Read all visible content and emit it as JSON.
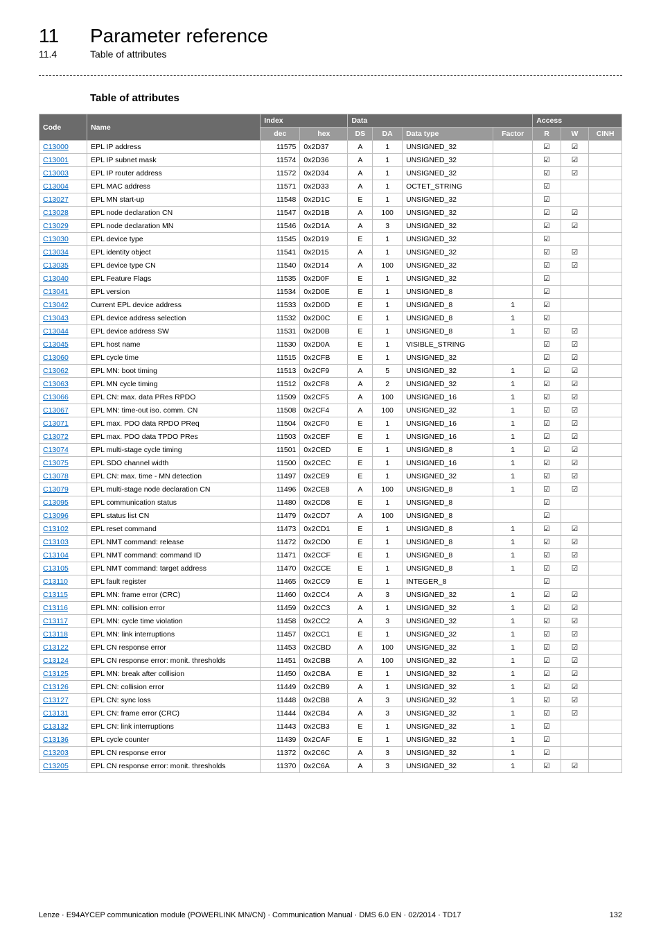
{
  "header": {
    "chapter_num": "11",
    "chapter_title": "Parameter reference",
    "section_num": "11.4",
    "section_title": "Table of attributes"
  },
  "table": {
    "title": "Table of attributes",
    "col_groups": {
      "code": "Code",
      "name": "Name",
      "index": "Index",
      "data": "Data",
      "access": "Access"
    },
    "cols": {
      "dec": "dec",
      "hex": "hex",
      "ds": "DS",
      "da": "DA",
      "dtype": "Data type",
      "factor": "Factor",
      "r": "R",
      "w": "W",
      "cinh": "CINH"
    },
    "check": "☑",
    "rows": [
      {
        "code": "C13000",
        "name": "EPL IP address",
        "dec": "11575",
        "hex": "0x2D37",
        "ds": "A",
        "da": "1",
        "dtype": "UNSIGNED_32",
        "factor": "",
        "r": true,
        "w": true,
        "cinh": false
      },
      {
        "code": "C13001",
        "name": "EPL IP subnet mask",
        "dec": "11574",
        "hex": "0x2D36",
        "ds": "A",
        "da": "1",
        "dtype": "UNSIGNED_32",
        "factor": "",
        "r": true,
        "w": true,
        "cinh": false
      },
      {
        "code": "C13003",
        "name": "EPL IP router address",
        "dec": "11572",
        "hex": "0x2D34",
        "ds": "A",
        "da": "1",
        "dtype": "UNSIGNED_32",
        "factor": "",
        "r": true,
        "w": true,
        "cinh": false
      },
      {
        "code": "C13004",
        "name": "EPL MAC address",
        "dec": "11571",
        "hex": "0x2D33",
        "ds": "A",
        "da": "1",
        "dtype": "OCTET_STRING",
        "factor": "",
        "r": true,
        "w": false,
        "cinh": false
      },
      {
        "code": "C13027",
        "name": "EPL MN start-up",
        "dec": "11548",
        "hex": "0x2D1C",
        "ds": "E",
        "da": "1",
        "dtype": "UNSIGNED_32",
        "factor": "",
        "r": true,
        "w": false,
        "cinh": false
      },
      {
        "code": "C13028",
        "name": "EPL node declaration CN",
        "dec": "11547",
        "hex": "0x2D1B",
        "ds": "A",
        "da": "100",
        "dtype": "UNSIGNED_32",
        "factor": "",
        "r": true,
        "w": true,
        "cinh": false
      },
      {
        "code": "C13029",
        "name": "EPL node declaration MN",
        "dec": "11546",
        "hex": "0x2D1A",
        "ds": "A",
        "da": "3",
        "dtype": "UNSIGNED_32",
        "factor": "",
        "r": true,
        "w": true,
        "cinh": false
      },
      {
        "code": "C13030",
        "name": "EPL device type",
        "dec": "11545",
        "hex": "0x2D19",
        "ds": "E",
        "da": "1",
        "dtype": "UNSIGNED_32",
        "factor": "",
        "r": true,
        "w": false,
        "cinh": false
      },
      {
        "code": "C13034",
        "name": "EPL identity object",
        "dec": "11541",
        "hex": "0x2D15",
        "ds": "A",
        "da": "1",
        "dtype": "UNSIGNED_32",
        "factor": "",
        "r": true,
        "w": true,
        "cinh": false
      },
      {
        "code": "C13035",
        "name": "EPL device type CN",
        "dec": "11540",
        "hex": "0x2D14",
        "ds": "A",
        "da": "100",
        "dtype": "UNSIGNED_32",
        "factor": "",
        "r": true,
        "w": true,
        "cinh": false
      },
      {
        "code": "C13040",
        "name": "EPL Feature Flags",
        "dec": "11535",
        "hex": "0x2D0F",
        "ds": "E",
        "da": "1",
        "dtype": "UNSIGNED_32",
        "factor": "",
        "r": true,
        "w": false,
        "cinh": false
      },
      {
        "code": "C13041",
        "name": "EPL version",
        "dec": "11534",
        "hex": "0x2D0E",
        "ds": "E",
        "da": "1",
        "dtype": "UNSIGNED_8",
        "factor": "",
        "r": true,
        "w": false,
        "cinh": false
      },
      {
        "code": "C13042",
        "name": "Current EPL device address",
        "dec": "11533",
        "hex": "0x2D0D",
        "ds": "E",
        "da": "1",
        "dtype": "UNSIGNED_8",
        "factor": "1",
        "r": true,
        "w": false,
        "cinh": false
      },
      {
        "code": "C13043",
        "name": "EPL device address selection",
        "dec": "11532",
        "hex": "0x2D0C",
        "ds": "E",
        "da": "1",
        "dtype": "UNSIGNED_8",
        "factor": "1",
        "r": true,
        "w": false,
        "cinh": false
      },
      {
        "code": "C13044",
        "name": "EPL device address SW",
        "dec": "11531",
        "hex": "0x2D0B",
        "ds": "E",
        "da": "1",
        "dtype": "UNSIGNED_8",
        "factor": "1",
        "r": true,
        "w": true,
        "cinh": false
      },
      {
        "code": "C13045",
        "name": "EPL host name",
        "dec": "11530",
        "hex": "0x2D0A",
        "ds": "E",
        "da": "1",
        "dtype": "VISIBLE_STRING",
        "factor": "",
        "r": true,
        "w": true,
        "cinh": false
      },
      {
        "code": "C13060",
        "name": "EPL cycle time",
        "dec": "11515",
        "hex": "0x2CFB",
        "ds": "E",
        "da": "1",
        "dtype": "UNSIGNED_32",
        "factor": "",
        "r": true,
        "w": true,
        "cinh": false
      },
      {
        "code": "C13062",
        "name": "EPL MN: boot timing",
        "dec": "11513",
        "hex": "0x2CF9",
        "ds": "A",
        "da": "5",
        "dtype": "UNSIGNED_32",
        "factor": "1",
        "r": true,
        "w": true,
        "cinh": false
      },
      {
        "code": "C13063",
        "name": "EPL MN cycle timing",
        "dec": "11512",
        "hex": "0x2CF8",
        "ds": "A",
        "da": "2",
        "dtype": "UNSIGNED_32",
        "factor": "1",
        "r": true,
        "w": true,
        "cinh": false
      },
      {
        "code": "C13066",
        "name": "EPL CN: max. data PRes RPDO",
        "dec": "11509",
        "hex": "0x2CF5",
        "ds": "A",
        "da": "100",
        "dtype": "UNSIGNED_16",
        "factor": "1",
        "r": true,
        "w": true,
        "cinh": false
      },
      {
        "code": "C13067",
        "name": "EPL MN: time-out iso. comm. CN",
        "dec": "11508",
        "hex": "0x2CF4",
        "ds": "A",
        "da": "100",
        "dtype": "UNSIGNED_32",
        "factor": "1",
        "r": true,
        "w": true,
        "cinh": false
      },
      {
        "code": "C13071",
        "name": "EPL max. PDO data RPDO PReq",
        "dec": "11504",
        "hex": "0x2CF0",
        "ds": "E",
        "da": "1",
        "dtype": "UNSIGNED_16",
        "factor": "1",
        "r": true,
        "w": true,
        "cinh": false
      },
      {
        "code": "C13072",
        "name": "EPL max. PDO data TPDO PRes",
        "dec": "11503",
        "hex": "0x2CEF",
        "ds": "E",
        "da": "1",
        "dtype": "UNSIGNED_16",
        "factor": "1",
        "r": true,
        "w": true,
        "cinh": false
      },
      {
        "code": "C13074",
        "name": "EPL multi-stage cycle timing",
        "dec": "11501",
        "hex": "0x2CED",
        "ds": "E",
        "da": "1",
        "dtype": "UNSIGNED_8",
        "factor": "1",
        "r": true,
        "w": true,
        "cinh": false
      },
      {
        "code": "C13075",
        "name": "EPL SDO channel width",
        "dec": "11500",
        "hex": "0x2CEC",
        "ds": "E",
        "da": "1",
        "dtype": "UNSIGNED_16",
        "factor": "1",
        "r": true,
        "w": true,
        "cinh": false
      },
      {
        "code": "C13078",
        "name": "EPL CN: max. time - MN detection",
        "dec": "11497",
        "hex": "0x2CE9",
        "ds": "E",
        "da": "1",
        "dtype": "UNSIGNED_32",
        "factor": "1",
        "r": true,
        "w": true,
        "cinh": false
      },
      {
        "code": "C13079",
        "name": "EPL multi-stage node declaration CN",
        "dec": "11496",
        "hex": "0x2CE8",
        "ds": "A",
        "da": "100",
        "dtype": "UNSIGNED_8",
        "factor": "1",
        "r": true,
        "w": true,
        "cinh": false
      },
      {
        "code": "C13095",
        "name": "EPL communication status",
        "dec": "11480",
        "hex": "0x2CD8",
        "ds": "E",
        "da": "1",
        "dtype": "UNSIGNED_8",
        "factor": "",
        "r": true,
        "w": false,
        "cinh": false
      },
      {
        "code": "C13096",
        "name": "EPL status list CN",
        "dec": "11479",
        "hex": "0x2CD7",
        "ds": "A",
        "da": "100",
        "dtype": "UNSIGNED_8",
        "factor": "",
        "r": true,
        "w": false,
        "cinh": false
      },
      {
        "code": "C13102",
        "name": "EPL reset command",
        "dec": "11473",
        "hex": "0x2CD1",
        "ds": "E",
        "da": "1",
        "dtype": "UNSIGNED_8",
        "factor": "1",
        "r": true,
        "w": true,
        "cinh": false
      },
      {
        "code": "C13103",
        "name": "EPL NMT command: release",
        "dec": "11472",
        "hex": "0x2CD0",
        "ds": "E",
        "da": "1",
        "dtype": "UNSIGNED_8",
        "factor": "1",
        "r": true,
        "w": true,
        "cinh": false
      },
      {
        "code": "C13104",
        "name": "EPL NMT command: command ID",
        "dec": "11471",
        "hex": "0x2CCF",
        "ds": "E",
        "da": "1",
        "dtype": "UNSIGNED_8",
        "factor": "1",
        "r": true,
        "w": true,
        "cinh": false
      },
      {
        "code": "C13105",
        "name": "EPL NMT command: target address",
        "dec": "11470",
        "hex": "0x2CCE",
        "ds": "E",
        "da": "1",
        "dtype": "UNSIGNED_8",
        "factor": "1",
        "r": true,
        "w": true,
        "cinh": false
      },
      {
        "code": "C13110",
        "name": "EPL fault register",
        "dec": "11465",
        "hex": "0x2CC9",
        "ds": "E",
        "da": "1",
        "dtype": "INTEGER_8",
        "factor": "",
        "r": true,
        "w": false,
        "cinh": false
      },
      {
        "code": "C13115",
        "name": "EPL MN: frame error (CRC)",
        "dec": "11460",
        "hex": "0x2CC4",
        "ds": "A",
        "da": "3",
        "dtype": "UNSIGNED_32",
        "factor": "1",
        "r": true,
        "w": true,
        "cinh": false
      },
      {
        "code": "C13116",
        "name": "EPL MN: collision error",
        "dec": "11459",
        "hex": "0x2CC3",
        "ds": "A",
        "da": "1",
        "dtype": "UNSIGNED_32",
        "factor": "1",
        "r": true,
        "w": true,
        "cinh": false
      },
      {
        "code": "C13117",
        "name": "EPL MN: cycle time violation",
        "dec": "11458",
        "hex": "0x2CC2",
        "ds": "A",
        "da": "3",
        "dtype": "UNSIGNED_32",
        "factor": "1",
        "r": true,
        "w": true,
        "cinh": false
      },
      {
        "code": "C13118",
        "name": "EPL MN: link interruptions",
        "dec": "11457",
        "hex": "0x2CC1",
        "ds": "E",
        "da": "1",
        "dtype": "UNSIGNED_32",
        "factor": "1",
        "r": true,
        "w": true,
        "cinh": false
      },
      {
        "code": "C13122",
        "name": "EPL CN response error",
        "dec": "11453",
        "hex": "0x2CBD",
        "ds": "A",
        "da": "100",
        "dtype": "UNSIGNED_32",
        "factor": "1",
        "r": true,
        "w": true,
        "cinh": false
      },
      {
        "code": "C13124",
        "name": "EPL CN response error: monit. thresholds",
        "dec": "11451",
        "hex": "0x2CBB",
        "ds": "A",
        "da": "100",
        "dtype": "UNSIGNED_32",
        "factor": "1",
        "r": true,
        "w": true,
        "cinh": false
      },
      {
        "code": "C13125",
        "name": "EPL MN: break after collision",
        "dec": "11450",
        "hex": "0x2CBA",
        "ds": "E",
        "da": "1",
        "dtype": "UNSIGNED_32",
        "factor": "1",
        "r": true,
        "w": true,
        "cinh": false
      },
      {
        "code": "C13126",
        "name": "EPL CN: collision error",
        "dec": "11449",
        "hex": "0x2CB9",
        "ds": "A",
        "da": "1",
        "dtype": "UNSIGNED_32",
        "factor": "1",
        "r": true,
        "w": true,
        "cinh": false
      },
      {
        "code": "C13127",
        "name": "EPL CN: sync loss",
        "dec": "11448",
        "hex": "0x2CB8",
        "ds": "A",
        "da": "3",
        "dtype": "UNSIGNED_32",
        "factor": "1",
        "r": true,
        "w": true,
        "cinh": false
      },
      {
        "code": "C13131",
        "name": "EPL CN: frame error (CRC)",
        "dec": "11444",
        "hex": "0x2CB4",
        "ds": "A",
        "da": "3",
        "dtype": "UNSIGNED_32",
        "factor": "1",
        "r": true,
        "w": true,
        "cinh": false
      },
      {
        "code": "C13132",
        "name": "EPL CN: link interruptions",
        "dec": "11443",
        "hex": "0x2CB3",
        "ds": "E",
        "da": "1",
        "dtype": "UNSIGNED_32",
        "factor": "1",
        "r": true,
        "w": false,
        "cinh": false
      },
      {
        "code": "C13136",
        "name": "EPL cycle counter",
        "dec": "11439",
        "hex": "0x2CAF",
        "ds": "E",
        "da": "1",
        "dtype": "UNSIGNED_32",
        "factor": "1",
        "r": true,
        "w": false,
        "cinh": false
      },
      {
        "code": "C13203",
        "name": "EPL CN response error",
        "dec": "11372",
        "hex": "0x2C6C",
        "ds": "A",
        "da": "3",
        "dtype": "UNSIGNED_32",
        "factor": "1",
        "r": true,
        "w": false,
        "cinh": false
      },
      {
        "code": "C13205",
        "name": "EPL CN response error: monit. thresholds",
        "dec": "11370",
        "hex": "0x2C6A",
        "ds": "A",
        "da": "3",
        "dtype": "UNSIGNED_32",
        "factor": "1",
        "r": true,
        "w": true,
        "cinh": false
      }
    ]
  },
  "footer": {
    "left": "Lenze · E94AYCEP communication module (POWERLINK MN/CN) · Communication Manual · DMS 6.0 EN · 02/2014 · TD17",
    "right": "132"
  }
}
